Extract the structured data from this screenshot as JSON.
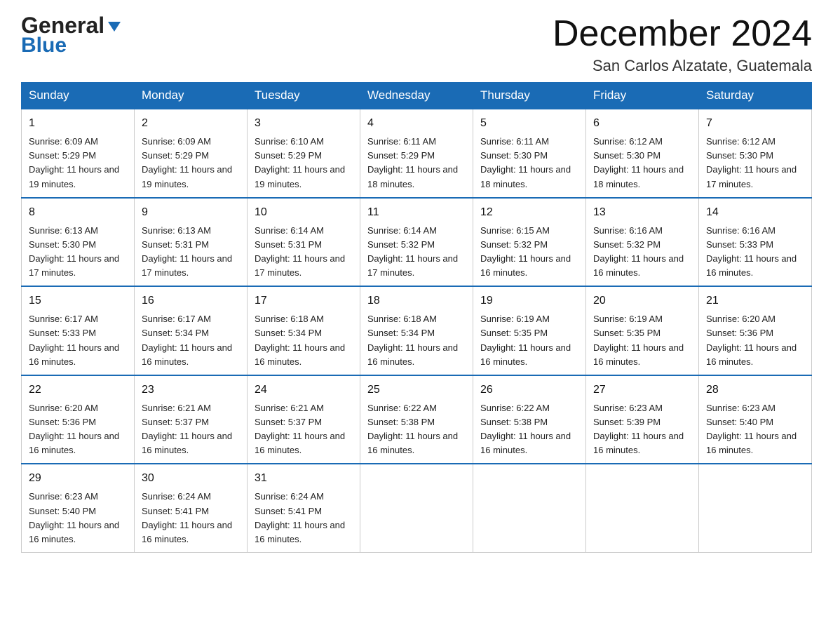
{
  "header": {
    "logo_general": "General",
    "logo_blue": "Blue",
    "main_title": "December 2024",
    "subtitle": "San Carlos Alzatate, Guatemala"
  },
  "calendar": {
    "days_of_week": [
      "Sunday",
      "Monday",
      "Tuesday",
      "Wednesday",
      "Thursday",
      "Friday",
      "Saturday"
    ],
    "weeks": [
      [
        {
          "day": "1",
          "sunrise": "Sunrise: 6:09 AM",
          "sunset": "Sunset: 5:29 PM",
          "daylight": "Daylight: 11 hours and 19 minutes."
        },
        {
          "day": "2",
          "sunrise": "Sunrise: 6:09 AM",
          "sunset": "Sunset: 5:29 PM",
          "daylight": "Daylight: 11 hours and 19 minutes."
        },
        {
          "day": "3",
          "sunrise": "Sunrise: 6:10 AM",
          "sunset": "Sunset: 5:29 PM",
          "daylight": "Daylight: 11 hours and 19 minutes."
        },
        {
          "day": "4",
          "sunrise": "Sunrise: 6:11 AM",
          "sunset": "Sunset: 5:29 PM",
          "daylight": "Daylight: 11 hours and 18 minutes."
        },
        {
          "day": "5",
          "sunrise": "Sunrise: 6:11 AM",
          "sunset": "Sunset: 5:30 PM",
          "daylight": "Daylight: 11 hours and 18 minutes."
        },
        {
          "day": "6",
          "sunrise": "Sunrise: 6:12 AM",
          "sunset": "Sunset: 5:30 PM",
          "daylight": "Daylight: 11 hours and 18 minutes."
        },
        {
          "day": "7",
          "sunrise": "Sunrise: 6:12 AM",
          "sunset": "Sunset: 5:30 PM",
          "daylight": "Daylight: 11 hours and 17 minutes."
        }
      ],
      [
        {
          "day": "8",
          "sunrise": "Sunrise: 6:13 AM",
          "sunset": "Sunset: 5:30 PM",
          "daylight": "Daylight: 11 hours and 17 minutes."
        },
        {
          "day": "9",
          "sunrise": "Sunrise: 6:13 AM",
          "sunset": "Sunset: 5:31 PM",
          "daylight": "Daylight: 11 hours and 17 minutes."
        },
        {
          "day": "10",
          "sunrise": "Sunrise: 6:14 AM",
          "sunset": "Sunset: 5:31 PM",
          "daylight": "Daylight: 11 hours and 17 minutes."
        },
        {
          "day": "11",
          "sunrise": "Sunrise: 6:14 AM",
          "sunset": "Sunset: 5:32 PM",
          "daylight": "Daylight: 11 hours and 17 minutes."
        },
        {
          "day": "12",
          "sunrise": "Sunrise: 6:15 AM",
          "sunset": "Sunset: 5:32 PM",
          "daylight": "Daylight: 11 hours and 16 minutes."
        },
        {
          "day": "13",
          "sunrise": "Sunrise: 6:16 AM",
          "sunset": "Sunset: 5:32 PM",
          "daylight": "Daylight: 11 hours and 16 minutes."
        },
        {
          "day": "14",
          "sunrise": "Sunrise: 6:16 AM",
          "sunset": "Sunset: 5:33 PM",
          "daylight": "Daylight: 11 hours and 16 minutes."
        }
      ],
      [
        {
          "day": "15",
          "sunrise": "Sunrise: 6:17 AM",
          "sunset": "Sunset: 5:33 PM",
          "daylight": "Daylight: 11 hours and 16 minutes."
        },
        {
          "day": "16",
          "sunrise": "Sunrise: 6:17 AM",
          "sunset": "Sunset: 5:34 PM",
          "daylight": "Daylight: 11 hours and 16 minutes."
        },
        {
          "day": "17",
          "sunrise": "Sunrise: 6:18 AM",
          "sunset": "Sunset: 5:34 PM",
          "daylight": "Daylight: 11 hours and 16 minutes."
        },
        {
          "day": "18",
          "sunrise": "Sunrise: 6:18 AM",
          "sunset": "Sunset: 5:34 PM",
          "daylight": "Daylight: 11 hours and 16 minutes."
        },
        {
          "day": "19",
          "sunrise": "Sunrise: 6:19 AM",
          "sunset": "Sunset: 5:35 PM",
          "daylight": "Daylight: 11 hours and 16 minutes."
        },
        {
          "day": "20",
          "sunrise": "Sunrise: 6:19 AM",
          "sunset": "Sunset: 5:35 PM",
          "daylight": "Daylight: 11 hours and 16 minutes."
        },
        {
          "day": "21",
          "sunrise": "Sunrise: 6:20 AM",
          "sunset": "Sunset: 5:36 PM",
          "daylight": "Daylight: 11 hours and 16 minutes."
        }
      ],
      [
        {
          "day": "22",
          "sunrise": "Sunrise: 6:20 AM",
          "sunset": "Sunset: 5:36 PM",
          "daylight": "Daylight: 11 hours and 16 minutes."
        },
        {
          "day": "23",
          "sunrise": "Sunrise: 6:21 AM",
          "sunset": "Sunset: 5:37 PM",
          "daylight": "Daylight: 11 hours and 16 minutes."
        },
        {
          "day": "24",
          "sunrise": "Sunrise: 6:21 AM",
          "sunset": "Sunset: 5:37 PM",
          "daylight": "Daylight: 11 hours and 16 minutes."
        },
        {
          "day": "25",
          "sunrise": "Sunrise: 6:22 AM",
          "sunset": "Sunset: 5:38 PM",
          "daylight": "Daylight: 11 hours and 16 minutes."
        },
        {
          "day": "26",
          "sunrise": "Sunrise: 6:22 AM",
          "sunset": "Sunset: 5:38 PM",
          "daylight": "Daylight: 11 hours and 16 minutes."
        },
        {
          "day": "27",
          "sunrise": "Sunrise: 6:23 AM",
          "sunset": "Sunset: 5:39 PM",
          "daylight": "Daylight: 11 hours and 16 minutes."
        },
        {
          "day": "28",
          "sunrise": "Sunrise: 6:23 AM",
          "sunset": "Sunset: 5:40 PM",
          "daylight": "Daylight: 11 hours and 16 minutes."
        }
      ],
      [
        {
          "day": "29",
          "sunrise": "Sunrise: 6:23 AM",
          "sunset": "Sunset: 5:40 PM",
          "daylight": "Daylight: 11 hours and 16 minutes."
        },
        {
          "day": "30",
          "sunrise": "Sunrise: 6:24 AM",
          "sunset": "Sunset: 5:41 PM",
          "daylight": "Daylight: 11 hours and 16 minutes."
        },
        {
          "day": "31",
          "sunrise": "Sunrise: 6:24 AM",
          "sunset": "Sunset: 5:41 PM",
          "daylight": "Daylight: 11 hours and 16 minutes."
        },
        null,
        null,
        null,
        null
      ]
    ]
  }
}
